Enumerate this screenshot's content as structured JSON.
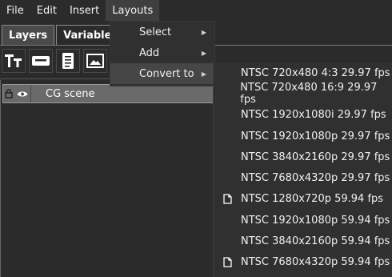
{
  "menubar": {
    "items": [
      "File",
      "Edit",
      "Insert",
      "Layouts"
    ],
    "active": "Layouts"
  },
  "tabs": [
    "Layers",
    "Variables"
  ],
  "toolbar": {
    "icons": [
      "text-icon",
      "textbox-icon",
      "document-icon",
      "image-icon"
    ]
  },
  "layer": {
    "name": "CG scene"
  },
  "layouts_menu": {
    "items": [
      "Select",
      "Add",
      "Convert to"
    ],
    "highlighted": "Convert to"
  },
  "convert_submenu": {
    "items": [
      {
        "label": "NTSC 720x480 4:3 29.97 fps",
        "icon": ""
      },
      {
        "label": "NTSC 720x480 16:9 29.97 fps",
        "icon": ""
      },
      {
        "label": "NTSC 1920x1080i 29.97 fps",
        "icon": ""
      },
      {
        "label": "NTSC 1920x1080p 29.97 fps",
        "icon": ""
      },
      {
        "label": "NTSC 3840x2160p 29.97 fps",
        "icon": ""
      },
      {
        "label": "NTSC 7680x4320p 29.97 fps",
        "icon": ""
      },
      {
        "label": "NTSC 1280x720p 59.94 fps",
        "icon": "document-icon"
      },
      {
        "label": "NTSC 1920x1080p 59.94 fps",
        "icon": ""
      },
      {
        "label": "NTSC 3840x2160p 59.94 fps",
        "icon": ""
      },
      {
        "label": "NTSC 7680x4320p 59.94 fps",
        "icon": "document-icon"
      }
    ]
  }
}
